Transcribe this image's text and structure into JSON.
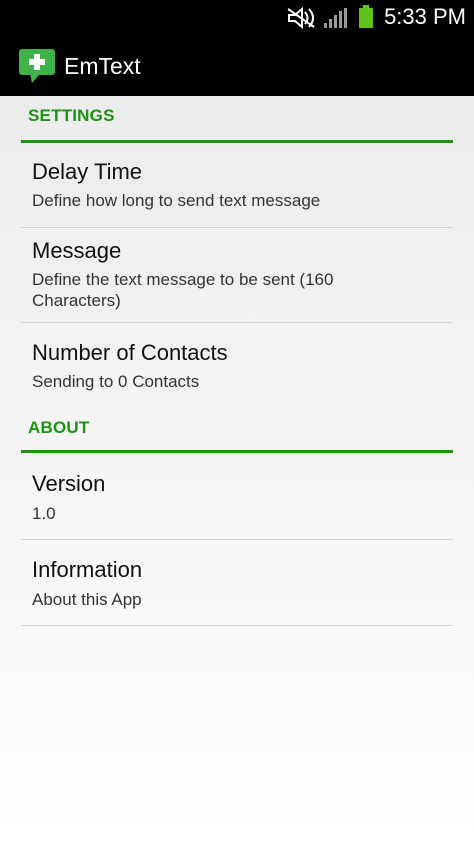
{
  "status_bar": {
    "time": "5:33 PM",
    "icons": [
      "no-sound-icon",
      "signal-icon",
      "battery-icon"
    ],
    "battery_color": "#63c21a"
  },
  "action_bar": {
    "title": "EmText",
    "icon": "message-plus-icon",
    "icon_color": "#3db34a"
  },
  "accent_color": "#1b9410",
  "sections": {
    "settings": {
      "header": "SETTINGS",
      "items": [
        {
          "title": "Delay Time",
          "summary": "Define how long to send text message"
        },
        {
          "title": "Message",
          "summary": "Define the text message to be sent (160 Characters)"
        },
        {
          "title": "Number of Contacts",
          "summary": "Sending to 0 Contacts"
        }
      ]
    },
    "about": {
      "header": "ABOUT",
      "items": [
        {
          "title": "Version",
          "summary": "1.0"
        },
        {
          "title": "Information",
          "summary": "About this App"
        }
      ]
    }
  }
}
